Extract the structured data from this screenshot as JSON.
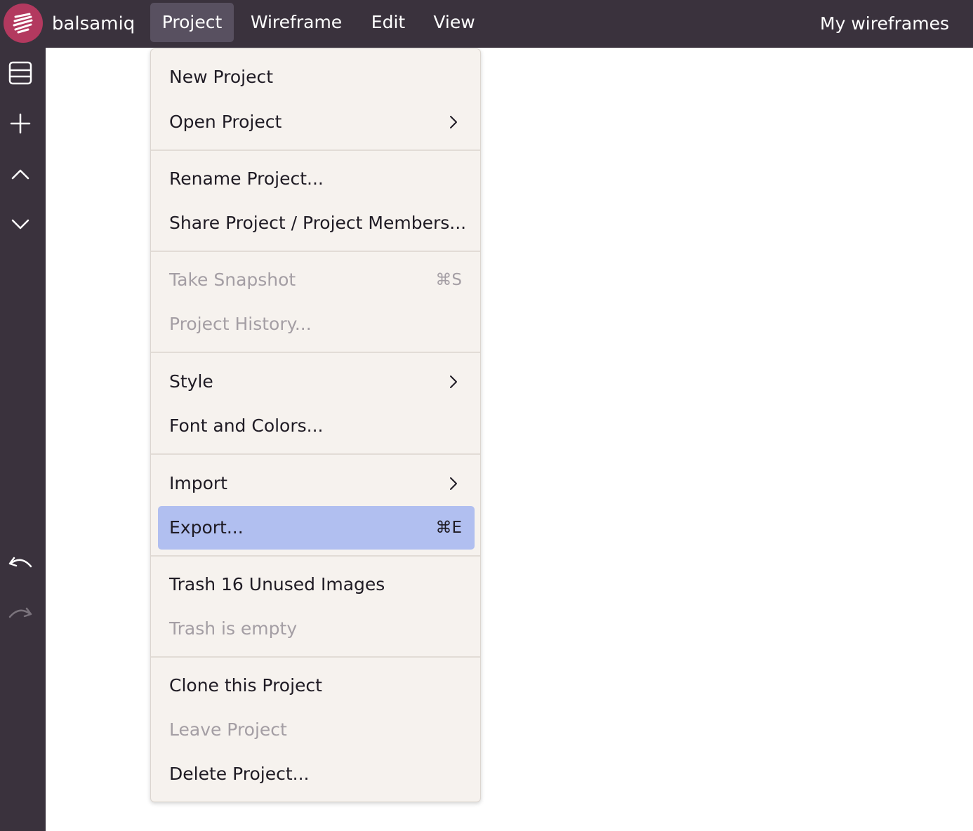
{
  "app": {
    "brand": "balsamiq"
  },
  "menubar": {
    "tabs": [
      "Project",
      "Wireframe",
      "Edit",
      "View"
    ],
    "active_tab": "Project",
    "right_link": "My wireframes"
  },
  "sidebar": {
    "icons": [
      "wireframe-list-icon",
      "plus-icon",
      "chevron-up-icon",
      "chevron-down-icon",
      "undo-icon",
      "redo-icon"
    ]
  },
  "project_menu": {
    "items": [
      {
        "label": "New Project"
      },
      {
        "label": "Open Project",
        "submenu": true
      },
      {
        "label": "Rename Project..."
      },
      {
        "label": "Share Project / Project Members..."
      },
      {
        "label": "Take Snapshot",
        "shortcut": "⌘S",
        "disabled": true
      },
      {
        "label": "Project History...",
        "disabled": true
      },
      {
        "label": "Style",
        "submenu": true
      },
      {
        "label": "Font and Colors..."
      },
      {
        "label": "Import",
        "submenu": true
      },
      {
        "label": "Export...",
        "shortcut": "⌘E",
        "highlighted": true
      },
      {
        "label": "Trash 16 Unused Images"
      },
      {
        "label": "Trash is empty",
        "disabled": true
      },
      {
        "label": "Clone this Project"
      },
      {
        "label": "Leave Project",
        "disabled": true
      },
      {
        "label": "Delete Project..."
      }
    ]
  },
  "colors": {
    "topbar_bg": "#3a323d",
    "logo_bg": "#b3395f",
    "menu_bg": "#f6f2ee",
    "highlight_bg": "#b1bff0",
    "disabled_text": "#a49ea4"
  }
}
